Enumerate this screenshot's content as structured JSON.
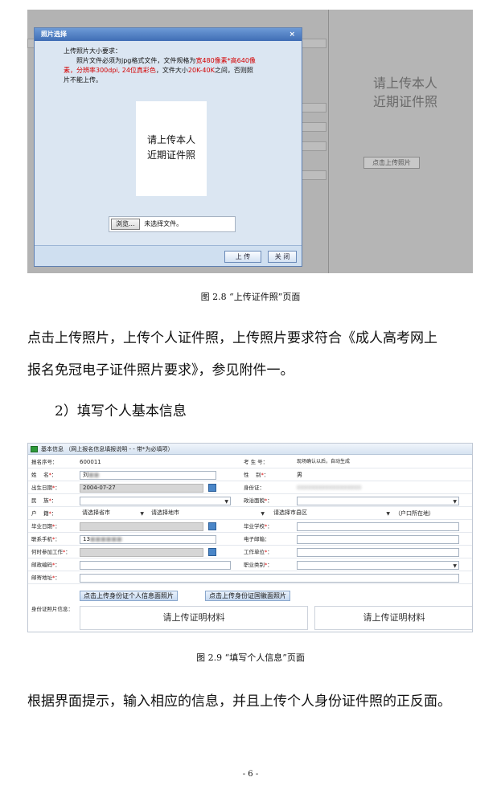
{
  "figure1": {
    "bg_placeholder_lines": [
      "请上传本人",
      "近期证件照"
    ],
    "bg_upload_button": "点击上传照片",
    "dialog": {
      "title": "照片选择",
      "close_glyph": "×",
      "req_heading": "上传照片大小要求：",
      "req_line1_a": "照片文件必须为jpg格式文件，文件规格为",
      "req_line1_b": "宽480像素*高640像",
      "req_line2_a": "素，分辨率300dpi, 24位真彩色",
      "req_line2_b": "，文件大小",
      "req_line2_c": "20K-40K",
      "req_line2_d": "之间，否则照",
      "req_line3": "片不能上传。",
      "photo_lines": [
        "请上传本人",
        "近期证件照"
      ],
      "browse_label": "浏览...",
      "file_status": "未选择文件。",
      "upload_label": "上 传",
      "close_label": "关 闭"
    },
    "caption": "图 2.8    “上传证件照”页面"
  },
  "para1_lines": [
    "点击上传照片，上传个人证件照，上传照片要求符合《成人高考网上",
    "报名免冠电子证件照片要求》，参见附件一。"
  ],
  "heading2": "2）填写个人基本信息",
  "figure2": {
    "header": "基本信息 （网上报名信息填报说明 - - 带*为必填项）",
    "fields": {
      "reg_no_label": "报名序号：",
      "reg_no_value": "600011",
      "exam_no_label": "考 生 号：",
      "exam_no_value": "现场确认以后，自动生成",
      "name_label": "姓　 名",
      "name_value": "刘",
      "gender_label": "性　 别",
      "gender_value": "男",
      "birth_label": "出生日期",
      "birth_value": "2004-07-27",
      "id_label": "身份证：",
      "id_value": "000000000000000000",
      "ethnic_label": "民　 族",
      "politic_label": "政治面貌",
      "hukou_label": "户　 籍",
      "province_placeholder": "请选择省市",
      "city_placeholder": "请选择地市",
      "county_placeholder": "请选择市县区",
      "hukou_note": "（户口所在地）",
      "grad_date_label": "毕业日期",
      "grad_school_label": "毕业学校",
      "phone_label": "联系手机",
      "phone_value": "13",
      "email_label": "电子邮箱：",
      "work_date_label": "何时参加工作",
      "work_unit_label": "工作单位",
      "postcode_label": "邮政编码",
      "job_label": "职业类别",
      "address_label": "邮寄地址"
    },
    "btn_front": "点击上传身份证个人信息面照片",
    "btn_back": "点击上传身份证国徽面照片",
    "idphoto_label": "身份证照片信息：",
    "upload_left": "请上传证明材料",
    "upload_right": "请上传证明材料",
    "caption": "图 2.9    “填写个人信息”页面"
  },
  "para2": "根据界面提示，输入相应的信息，并且上传个人身份证件照的正反面。",
  "page_number": "- 6 -"
}
